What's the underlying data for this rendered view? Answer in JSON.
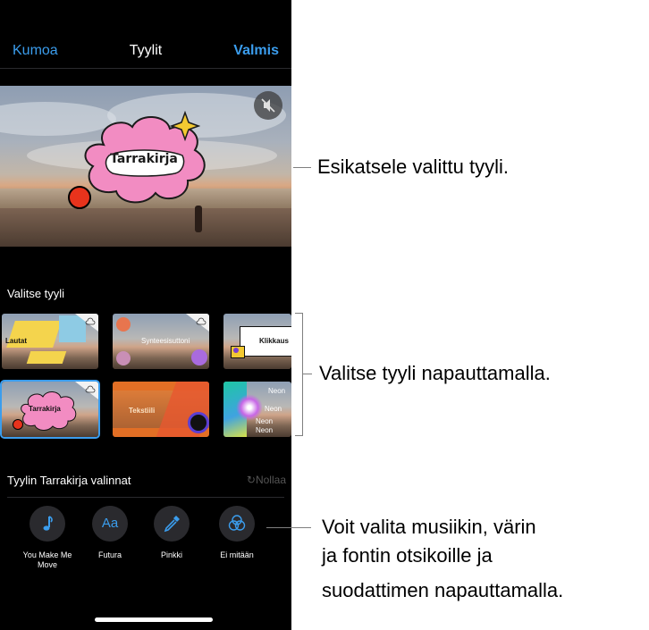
{
  "nav": {
    "undo_label": "Kumoa",
    "title": "Tyylit",
    "done_label": "Valmis"
  },
  "preview": {
    "sticker_text": "Tarrakirja",
    "mute_icon": "speaker-slash-icon"
  },
  "style_section": {
    "heading": "Valitse tyyli",
    "styles": [
      {
        "label": "Lautat",
        "selected": false,
        "download_icon": "cloud-download-icon"
      },
      {
        "label": "Synteesisuttoni",
        "selected": false,
        "download_icon": "cloud-download-icon"
      },
      {
        "label": "Klikkaus",
        "selected": false
      },
      {
        "label": "Tarrakirja",
        "selected": true,
        "download_icon": "cloud-download-icon"
      },
      {
        "label": "Tekstiili",
        "selected": false
      },
      {
        "label": "Neon",
        "selected": false,
        "extra_labels": [
          "Neon",
          "Neon",
          "Neon"
        ]
      }
    ]
  },
  "options": {
    "heading": "Tyylin Tarrakirja valinnat",
    "reset_label": "Nollaa",
    "items": [
      {
        "icon": "music-note-icon",
        "label": "You Make Me Move"
      },
      {
        "icon": "text-format-icon",
        "glyph": "Aa",
        "label": "Futura"
      },
      {
        "icon": "eyedropper-icon",
        "label": "Pinkki"
      },
      {
        "icon": "filter-circles-icon",
        "label": "Ei mitään"
      }
    ]
  },
  "callouts": {
    "preview": "Esikatsele valittu tyyli.",
    "styles": "Valitse tyyli napauttamalla.",
    "options_line1": "Voit valita musiikin, värin",
    "options_line2": "ja fontin otsikoille ja",
    "options_line3": "suodattimen napauttamalla."
  },
  "colors": {
    "accent": "#3b9ded",
    "background": "#000000",
    "button": "#2a2a2e",
    "sticker_pink": "#f28cc2",
    "sticker_red": "#e8331c"
  }
}
